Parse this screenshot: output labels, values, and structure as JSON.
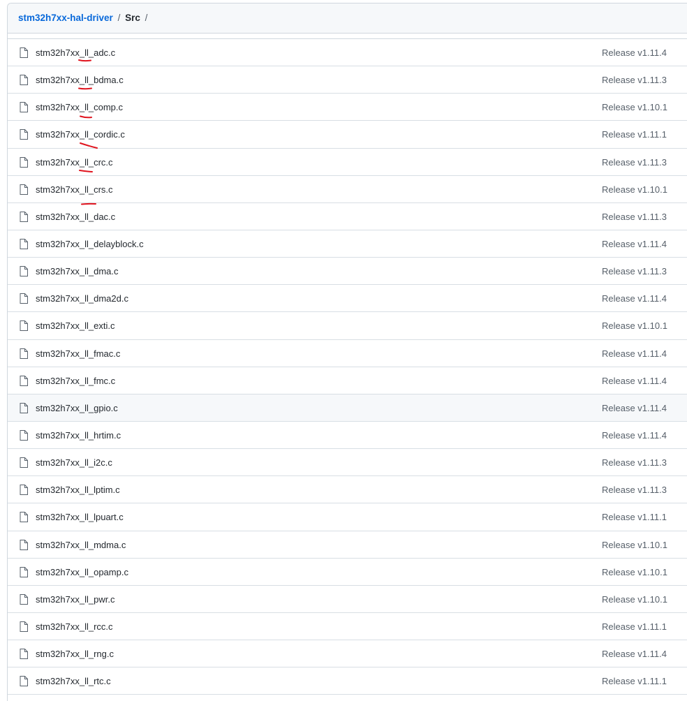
{
  "breadcrumb": {
    "repo": "stm32h7xx-hal-driver",
    "separator": "/",
    "directory": "Src",
    "trailing": "/"
  },
  "icons": {
    "file": "file-icon"
  },
  "colors": {
    "link": "#0969da",
    "annotation": "#e0141e",
    "row_hover": "#f6f8fa"
  },
  "files": [
    {
      "name": "stm32h7xx_ll_adc.c",
      "commit": "Release v1.11.4"
    },
    {
      "name": "stm32h7xx_ll_bdma.c",
      "commit": "Release v1.11.3"
    },
    {
      "name": "stm32h7xx_ll_comp.c",
      "commit": "Release v1.10.1"
    },
    {
      "name": "stm32h7xx_ll_cordic.c",
      "commit": "Release v1.11.1"
    },
    {
      "name": "stm32h7xx_ll_crc.c",
      "commit": "Release v1.11.3"
    },
    {
      "name": "stm32h7xx_ll_crs.c",
      "commit": "Release v1.10.1"
    },
    {
      "name": "stm32h7xx_ll_dac.c",
      "commit": "Release v1.11.3"
    },
    {
      "name": "stm32h7xx_ll_delayblock.c",
      "commit": "Release v1.11.4"
    },
    {
      "name": "stm32h7xx_ll_dma.c",
      "commit": "Release v1.11.3"
    },
    {
      "name": "stm32h7xx_ll_dma2d.c",
      "commit": "Release v1.11.4"
    },
    {
      "name": "stm32h7xx_ll_exti.c",
      "commit": "Release v1.10.1"
    },
    {
      "name": "stm32h7xx_ll_fmac.c",
      "commit": "Release v1.11.4"
    },
    {
      "name": "stm32h7xx_ll_fmc.c",
      "commit": "Release v1.11.4"
    },
    {
      "name": "stm32h7xx_ll_gpio.c",
      "commit": "Release v1.11.4"
    },
    {
      "name": "stm32h7xx_ll_hrtim.c",
      "commit": "Release v1.11.4"
    },
    {
      "name": "stm32h7xx_ll_i2c.c",
      "commit": "Release v1.11.3"
    },
    {
      "name": "stm32h7xx_ll_lptim.c",
      "commit": "Release v1.11.3"
    },
    {
      "name": "stm32h7xx_ll_lpuart.c",
      "commit": "Release v1.11.1"
    },
    {
      "name": "stm32h7xx_ll_mdma.c",
      "commit": "Release v1.10.1"
    },
    {
      "name": "stm32h7xx_ll_opamp.c",
      "commit": "Release v1.10.1"
    },
    {
      "name": "stm32h7xx_ll_pwr.c",
      "commit": "Release v1.10.1"
    },
    {
      "name": "stm32h7xx_ll_rcc.c",
      "commit": "Release v1.11.1"
    },
    {
      "name": "stm32h7xx_ll_rng.c",
      "commit": "Release v1.11.4"
    },
    {
      "name": "stm32h7xx_ll_rtc.c",
      "commit": "Release v1.11.1"
    }
  ]
}
